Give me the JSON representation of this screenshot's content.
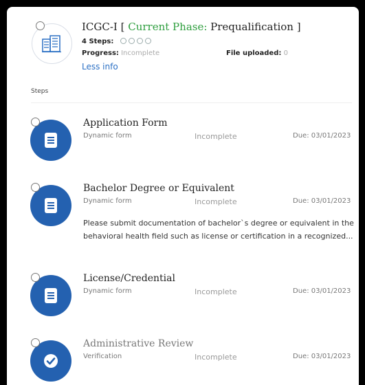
{
  "header": {
    "title_main": "ICGC-I [ ",
    "title_phase_label": "Current Phase:",
    "title_phase_value": " Prequalification ]",
    "steps_label": "4 Steps:",
    "progress_label": "Progress:",
    "progress_value": "Incomplete",
    "file_label": "File uploaded:",
    "file_value": "0",
    "less_info": "Less info",
    "icon": "building-icon",
    "accent_color": "#2e9e3e"
  },
  "section_label": "Steps",
  "steps": [
    {
      "title": "Application Form",
      "type": "Dynamic form",
      "status": "Incomplete",
      "due": "Due: 03/01/2023",
      "icon": "document-icon"
    },
    {
      "title": "Bachelor Degree or Equivalent",
      "type": "Dynamic form",
      "status": "Incomplete",
      "due": "Due: 03/01/2023",
      "description": "Please submit documentation of bachelor`s degree or equivalent in the behavioral health field such as license or certification in a recognized...",
      "icon": "document-icon"
    },
    {
      "title": "License/Credential",
      "type": "Dynamic form",
      "status": "Incomplete",
      "due": "Due: 03/01/2023",
      "icon": "document-icon"
    },
    {
      "title": "Administrative Review",
      "type": "Verification",
      "status": "Incomplete",
      "due": "Due: 03/01/2023",
      "icon": "check-icon"
    }
  ],
  "colors": {
    "step_circle": "#2461b0",
    "link": "#2a6fc4"
  }
}
